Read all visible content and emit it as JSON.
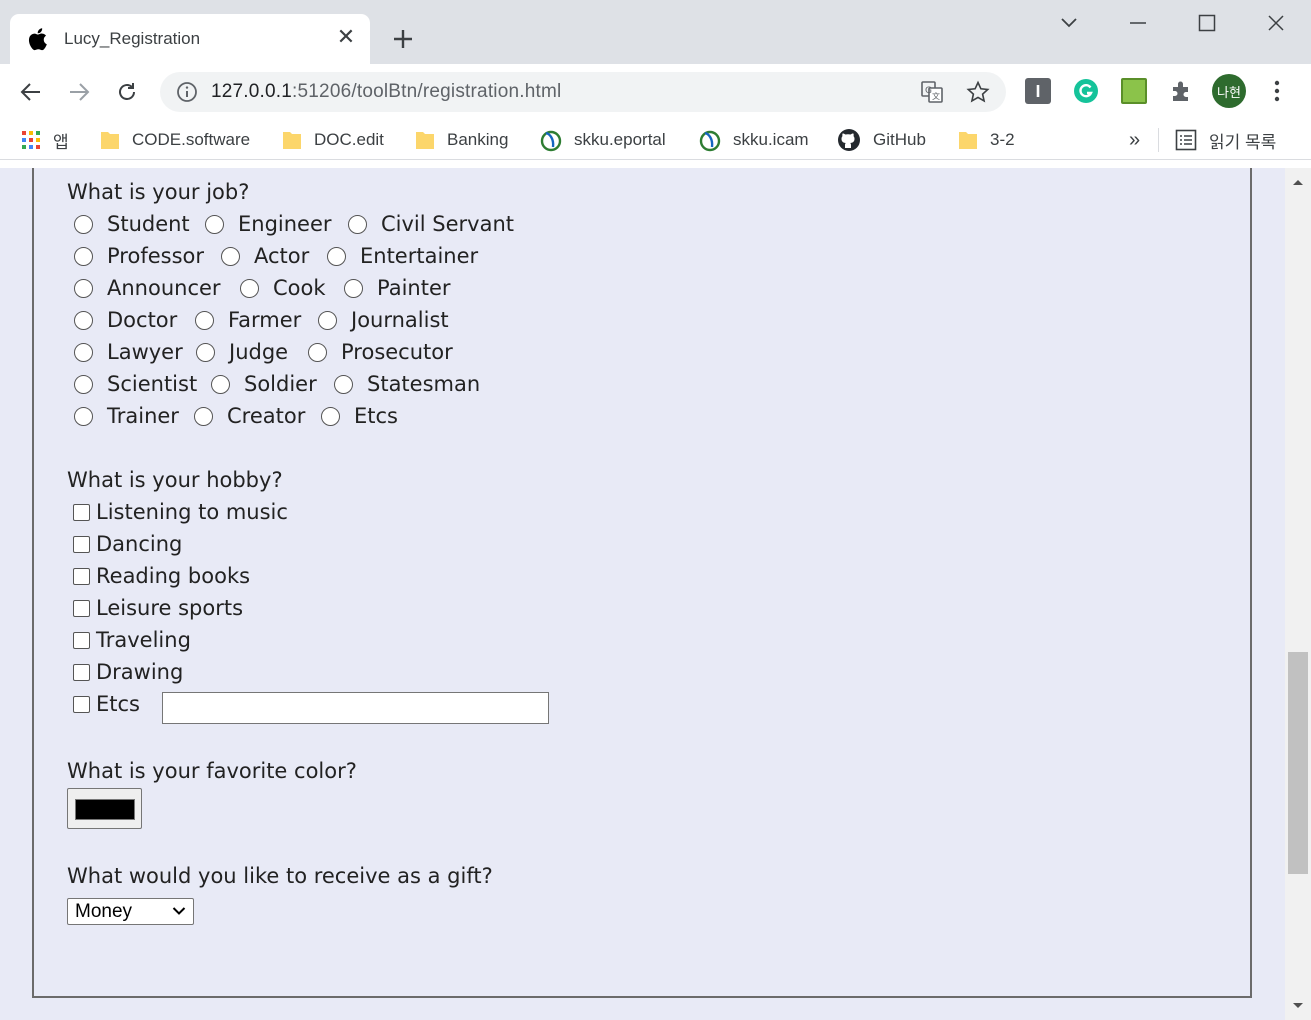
{
  "browser": {
    "tab_title": "Lucy_Registration",
    "tab_close": "✕",
    "url_host": "127.0.0.1",
    "url_rest": ":51206/toolBtn/registration.html",
    "profile_initial": "나현",
    "bookmarks": [
      "앱",
      "CODE.software",
      "DOC.edit",
      "Banking",
      "skku.eportal",
      "skku.icam",
      "GitHub",
      "3-2"
    ],
    "bookmarks_more": "»",
    "reading_list": "읽기 목록"
  },
  "form": {
    "job_question": "What is your job?",
    "jobs": [
      [
        "Student",
        "Engineer",
        "Civil Servant"
      ],
      [
        "Professor",
        "Actor",
        "Entertainer"
      ],
      [
        "Announcer",
        "Cook",
        "Painter"
      ],
      [
        "Doctor",
        "Farmer",
        "Journalist"
      ],
      [
        "Lawyer",
        "Judge",
        "Prosecutor"
      ],
      [
        "Scientist",
        "Soldier",
        "Statesman"
      ],
      [
        "Trainer",
        "Creator",
        "Etcs"
      ]
    ],
    "hobby_question": "What is your hobby?",
    "hobbies": [
      "Listening to music",
      "Dancing",
      "Reading books",
      "Leisure sports",
      "Traveling",
      "Drawing",
      "Etcs"
    ],
    "hobby_etc_value": "",
    "color_question": "What is your favorite color?",
    "favorite_color": "#000000",
    "gift_question": "What would you like to receive as a gift?",
    "gift_selected": "Money"
  }
}
